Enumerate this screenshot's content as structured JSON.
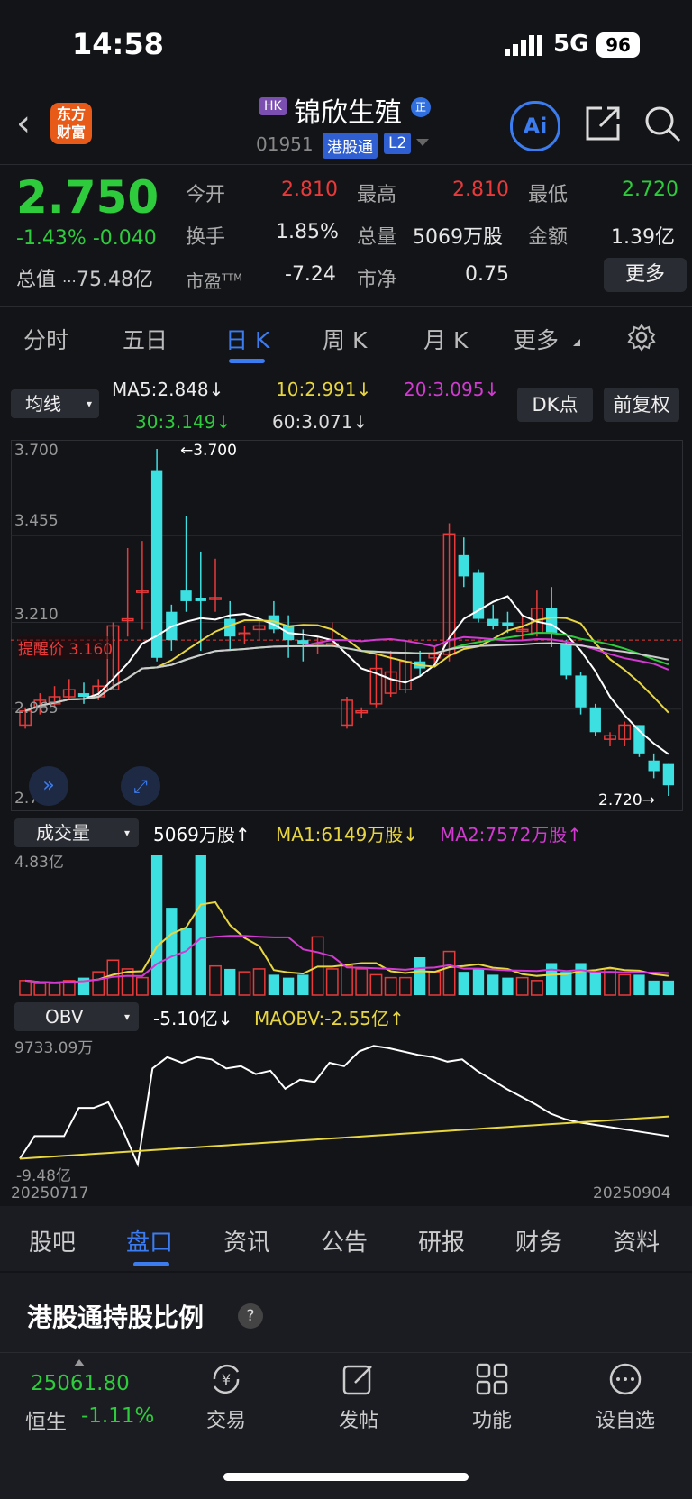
{
  "status": {
    "time": "14:58",
    "network": "5G",
    "battery": "96"
  },
  "header": {
    "app_logo": "东方\n财富",
    "market_tag": "HK",
    "stock_name": "锦欣生殖",
    "stock_code": "01951",
    "tags": [
      "港股通",
      "L2"
    ],
    "ai_label": "Ai",
    "icons": [
      "back-icon",
      "share-icon",
      "search-icon"
    ]
  },
  "quote": {
    "price": "2.750",
    "change_pct": "-1.43%",
    "change_abs": "-0.040",
    "market_value_label": "总值",
    "market_value": "75.48亿",
    "fields": {
      "open_label": "今开",
      "open": "2.810",
      "high_label": "最高",
      "high": "2.810",
      "low_label": "最低",
      "low": "2.720",
      "turnover_label": "换手",
      "turnover": "1.85%",
      "volume_label": "总量",
      "volume": "5069万股",
      "amount_label": "金额",
      "amount": "1.39亿",
      "pe_label": "市盈",
      "pe_sup": "TTM",
      "pe": "-7.24",
      "pb_label": "市净",
      "pb": "0.75"
    },
    "more_label": "更多"
  },
  "period_tabs": [
    "分时",
    "五日",
    "日 K",
    "周 K",
    "月 K",
    "更多"
  ],
  "active_period": "日 K",
  "indicators": {
    "ma_selector": "均线",
    "ma5": "MA5:2.848↓",
    "ma10": "10:2.991↓",
    "ma20": "20:3.095↓",
    "ma30": "30:3.149↓",
    "ma60": "60:3.071↓",
    "dk_label": "DK点",
    "adjust_label": "前复权",
    "alert_label": "提醒价 3.160",
    "high_marker": "←3.700",
    "low_marker": "2.720→"
  },
  "colors": {
    "ma5": "#ffffff",
    "ma10": "#e8d640",
    "ma20": "#d23ad2",
    "ma30": "#2ecc3c",
    "ma60": "#cccccc",
    "up": "#e83a3a",
    "down": "#3de0e0",
    "accent": "#3b7cf0"
  },
  "chart_data": [
    {
      "type": "candlestick",
      "y_ticks": [
        "3.700",
        "3.455",
        "3.210",
        "2.965",
        "2.720"
      ],
      "ylim": [
        2.72,
        3.7
      ],
      "candles": [
        {
          "o": 2.92,
          "c": 2.96,
          "h": 2.97,
          "l": 2.91
        },
        {
          "o": 2.97,
          "c": 2.99,
          "h": 3.01,
          "l": 2.95
        },
        {
          "o": 2.98,
          "c": 3.0,
          "h": 3.03,
          "l": 2.97
        },
        {
          "o": 3.0,
          "c": 3.02,
          "h": 3.05,
          "l": 2.99
        },
        {
          "o": 3.01,
          "c": 3.0,
          "h": 3.04,
          "l": 2.98
        },
        {
          "o": 3.0,
          "c": 3.03,
          "h": 3.05,
          "l": 2.99
        },
        {
          "o": 3.02,
          "c": 3.2,
          "h": 3.21,
          "l": 3.02
        },
        {
          "o": 3.22,
          "c": 3.22,
          "h": 3.42,
          "l": 3.17
        },
        {
          "o": 3.3,
          "c": 3.3,
          "h": 3.44,
          "l": 3.19
        },
        {
          "o": 3.64,
          "c": 3.11,
          "h": 3.7,
          "l": 3.1
        },
        {
          "o": 3.24,
          "c": 3.16,
          "h": 3.26,
          "l": 3.13
        },
        {
          "o": 3.3,
          "c": 3.27,
          "h": 3.51,
          "l": 3.24
        },
        {
          "o": 3.28,
          "c": 3.27,
          "h": 3.41,
          "l": 3.13
        },
        {
          "o": 3.28,
          "c": 3.28,
          "h": 3.39,
          "l": 3.24
        },
        {
          "o": 3.22,
          "c": 3.17,
          "h": 3.27,
          "l": 3.13
        },
        {
          "o": 3.18,
          "c": 3.18,
          "h": 3.2,
          "l": 3.15
        },
        {
          "o": 3.19,
          "c": 3.2,
          "h": 3.22,
          "l": 3.16
        },
        {
          "o": 3.23,
          "c": 3.19,
          "h": 3.27,
          "l": 3.18
        },
        {
          "o": 3.2,
          "c": 3.16,
          "h": 3.23,
          "l": 3.11
        },
        {
          "o": 3.16,
          "c": 3.15,
          "h": 3.19,
          "l": 3.1
        },
        {
          "o": 3.15,
          "c": 3.15,
          "h": 3.17,
          "l": 3.12
        },
        {
          "o": 3.15,
          "c": 3.15,
          "h": 3.21,
          "l": 3.14
        },
        {
          "o": 2.92,
          "c": 2.99,
          "h": 3.0,
          "l": 2.91
        },
        {
          "o": 2.96,
          "c": 2.96,
          "h": 2.97,
          "l": 2.94
        },
        {
          "o": 2.98,
          "c": 3.08,
          "h": 3.12,
          "l": 2.97
        },
        {
          "o": 3.01,
          "c": 3.07,
          "h": 3.13,
          "l": 3.0
        },
        {
          "o": 3.02,
          "c": 3.1,
          "h": 3.16,
          "l": 3.01
        },
        {
          "o": 3.1,
          "c": 3.08,
          "h": 3.13,
          "l": 3.06
        },
        {
          "o": 3.11,
          "c": 3.12,
          "h": 3.14,
          "l": 3.09
        },
        {
          "o": 3.12,
          "c": 3.46,
          "h": 3.49,
          "l": 3.1
        },
        {
          "o": 3.4,
          "c": 3.34,
          "h": 3.45,
          "l": 3.31
        },
        {
          "o": 3.35,
          "c": 3.22,
          "h": 3.36,
          "l": 3.21
        },
        {
          "o": 3.22,
          "c": 3.2,
          "h": 3.26,
          "l": 3.19
        },
        {
          "o": 3.21,
          "c": 3.2,
          "h": 3.24,
          "l": 3.18
        },
        {
          "o": 3.19,
          "c": 3.19,
          "h": 3.23,
          "l": 3.16
        },
        {
          "o": 3.18,
          "c": 3.25,
          "h": 3.3,
          "l": 3.17
        },
        {
          "o": 3.25,
          "c": 3.18,
          "h": 3.31,
          "l": 3.14
        },
        {
          "o": 3.15,
          "c": 3.06,
          "h": 3.16,
          "l": 3.05
        },
        {
          "o": 3.06,
          "c": 2.97,
          "h": 3.07,
          "l": 2.95
        },
        {
          "o": 2.97,
          "c": 2.9,
          "h": 2.98,
          "l": 2.89
        },
        {
          "o": 2.88,
          "c": 2.89,
          "h": 2.9,
          "l": 2.86
        },
        {
          "o": 2.88,
          "c": 2.92,
          "h": 2.93,
          "l": 2.86
        },
        {
          "o": 2.92,
          "c": 2.84,
          "h": 2.92,
          "l": 2.83
        },
        {
          "o": 2.82,
          "c": 2.79,
          "h": 2.84,
          "l": 2.77
        },
        {
          "o": 2.81,
          "c": 2.75,
          "h": 2.81,
          "l": 2.72
        }
      ]
    },
    {
      "type": "bar",
      "title": "成交量",
      "legend": [
        "5069万股↑",
        "MA1:6149万股↓",
        "MA2:7572万股↑"
      ],
      "y_top_label": "4.83亿",
      "ylim": [
        0,
        4.83
      ]
    },
    {
      "type": "line",
      "title": "OBV",
      "legend": [
        "-5.10亿↓",
        "MAOBV:-2.55亿↑"
      ],
      "y_top_label": "9733.09万",
      "y_bottom_label": "-9.48亿",
      "x_start": "20250717",
      "x_end": "20250904"
    }
  ],
  "detail_tabs": [
    "股吧",
    "盘口",
    "资讯",
    "公告",
    "研报",
    "财务",
    "资料"
  ],
  "active_detail_tab": "盘口",
  "section_title": "港股通持股比例",
  "section_help": "?",
  "footer": {
    "index_value": "25061.80",
    "index_name": "恒生",
    "index_change": "-1.11%",
    "items": [
      {
        "label": "交易",
        "icon": "trade-icon"
      },
      {
        "label": "发帖",
        "icon": "edit-icon"
      },
      {
        "label": "功能",
        "icon": "grid-icon"
      },
      {
        "label": "设自选",
        "icon": "more-icon"
      }
    ]
  }
}
